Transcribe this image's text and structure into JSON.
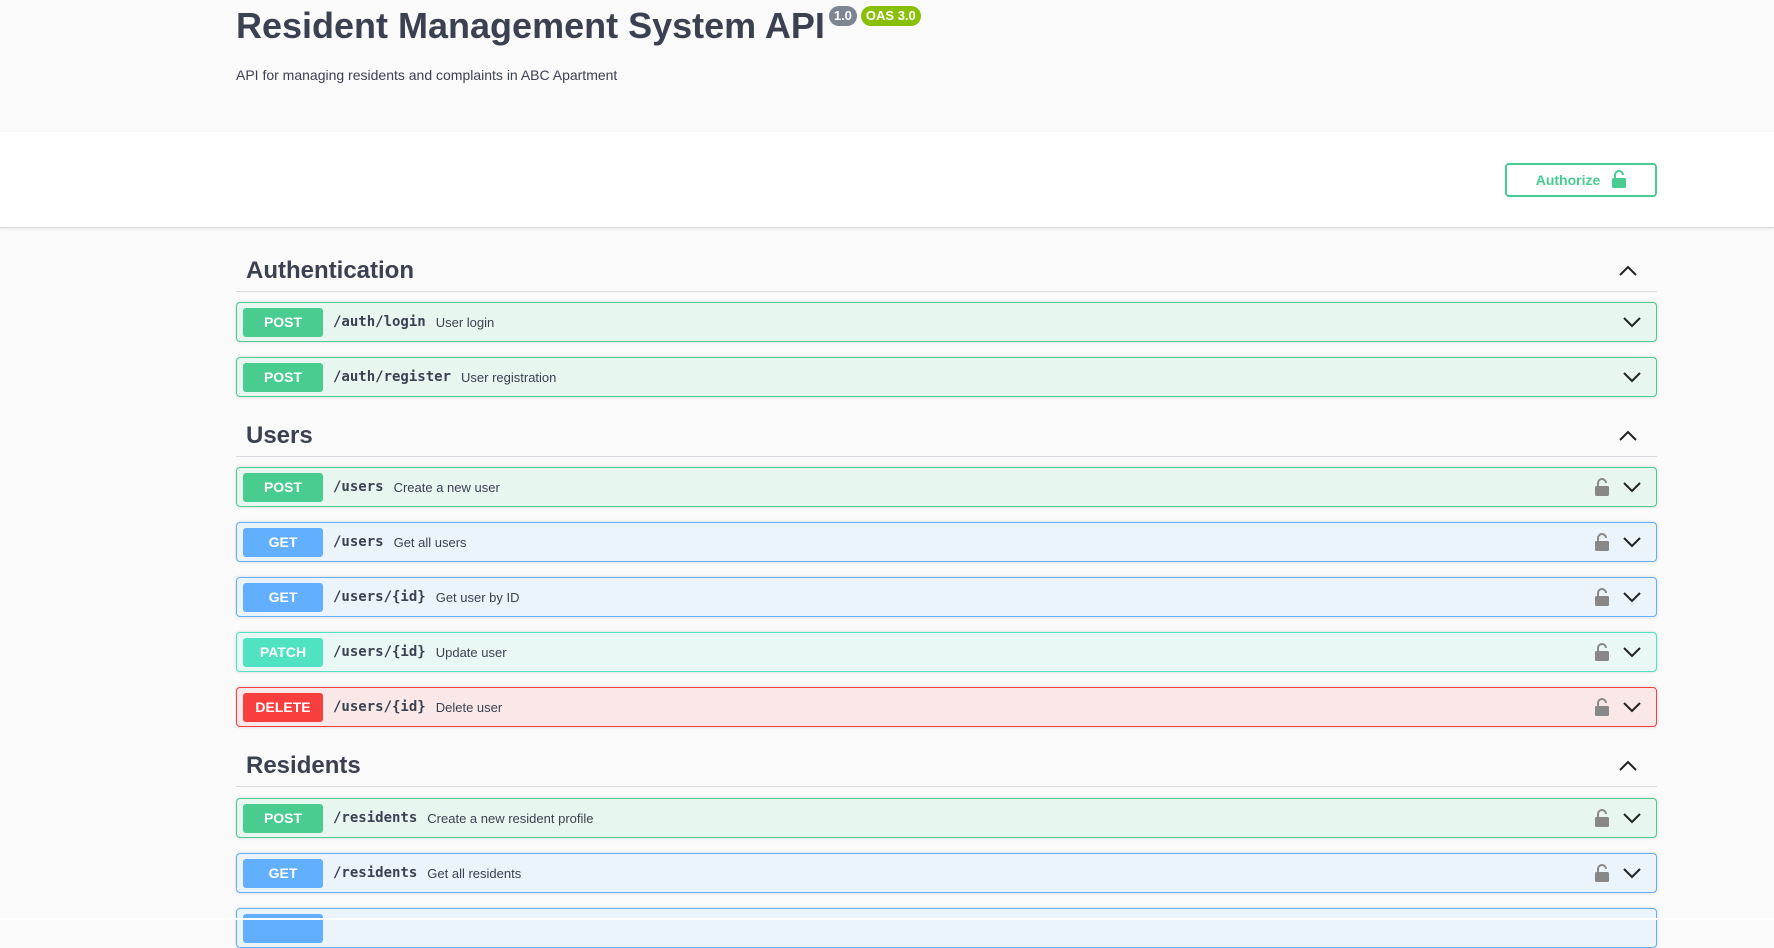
{
  "header": {
    "title": "Resident Management System API",
    "version_badge": "1.0",
    "oas_badge": "OAS 3.0",
    "description": "API for managing residents and complaints in ABC Apartment"
  },
  "authorize": {
    "label": "Authorize"
  },
  "colors": {
    "post": "#49cc90",
    "get": "#61affe",
    "patch": "#50e3c2",
    "delete": "#f93e3e"
  },
  "sections": [
    {
      "title": "Authentication",
      "operations": [
        {
          "method": "POST",
          "path": "/auth/login",
          "summary": "User login",
          "locked": false
        },
        {
          "method": "POST",
          "path": "/auth/register",
          "summary": "User registration",
          "locked": false
        }
      ]
    },
    {
      "title": "Users",
      "operations": [
        {
          "method": "POST",
          "path": "/users",
          "summary": "Create a new user",
          "locked": true
        },
        {
          "method": "GET",
          "path": "/users",
          "summary": "Get all users",
          "locked": true
        },
        {
          "method": "GET",
          "path": "/users/{id}",
          "summary": "Get user by ID",
          "locked": true
        },
        {
          "method": "PATCH",
          "path": "/users/{id}",
          "summary": "Update user",
          "locked": true
        },
        {
          "method": "DELETE",
          "path": "/users/{id}",
          "summary": "Delete user",
          "locked": true
        }
      ]
    },
    {
      "title": "Residents",
      "operations": [
        {
          "method": "POST",
          "path": "/residents",
          "summary": "Create a new resident profile",
          "locked": true
        },
        {
          "method": "GET",
          "path": "/residents",
          "summary": "Get all residents",
          "locked": true
        }
      ]
    }
  ]
}
